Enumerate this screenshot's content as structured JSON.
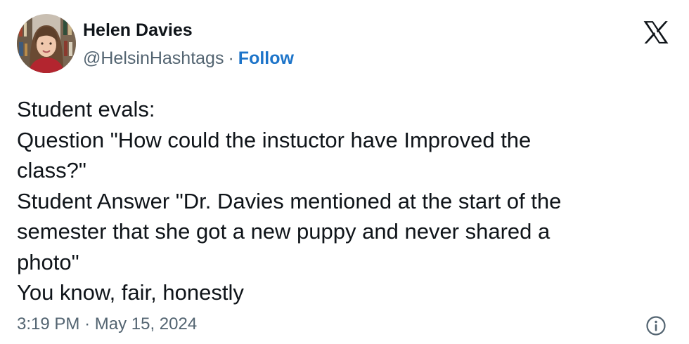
{
  "author": {
    "name": "Helen Davies",
    "handle": "@HelsinHashtags",
    "separator": "·",
    "follow_label": "Follow",
    "avatar_icon": "profile-photo"
  },
  "brand": {
    "logo_icon": "x-logo-icon",
    "follow_color": "#1d74c9"
  },
  "tweet": {
    "lines": [
      "Student evals:",
      "Question \"How could the instuctor have Improved the",
      "class?\"",
      "Student Answer \"Dr. Davies mentioned at the start of the",
      "semester that she got a new puppy and never shared a",
      "photo\"",
      "You know, fair, honestly"
    ]
  },
  "meta": {
    "time": "3:19 PM",
    "separator": "·",
    "date": "May 15, 2024",
    "info_icon": "info-icon"
  }
}
